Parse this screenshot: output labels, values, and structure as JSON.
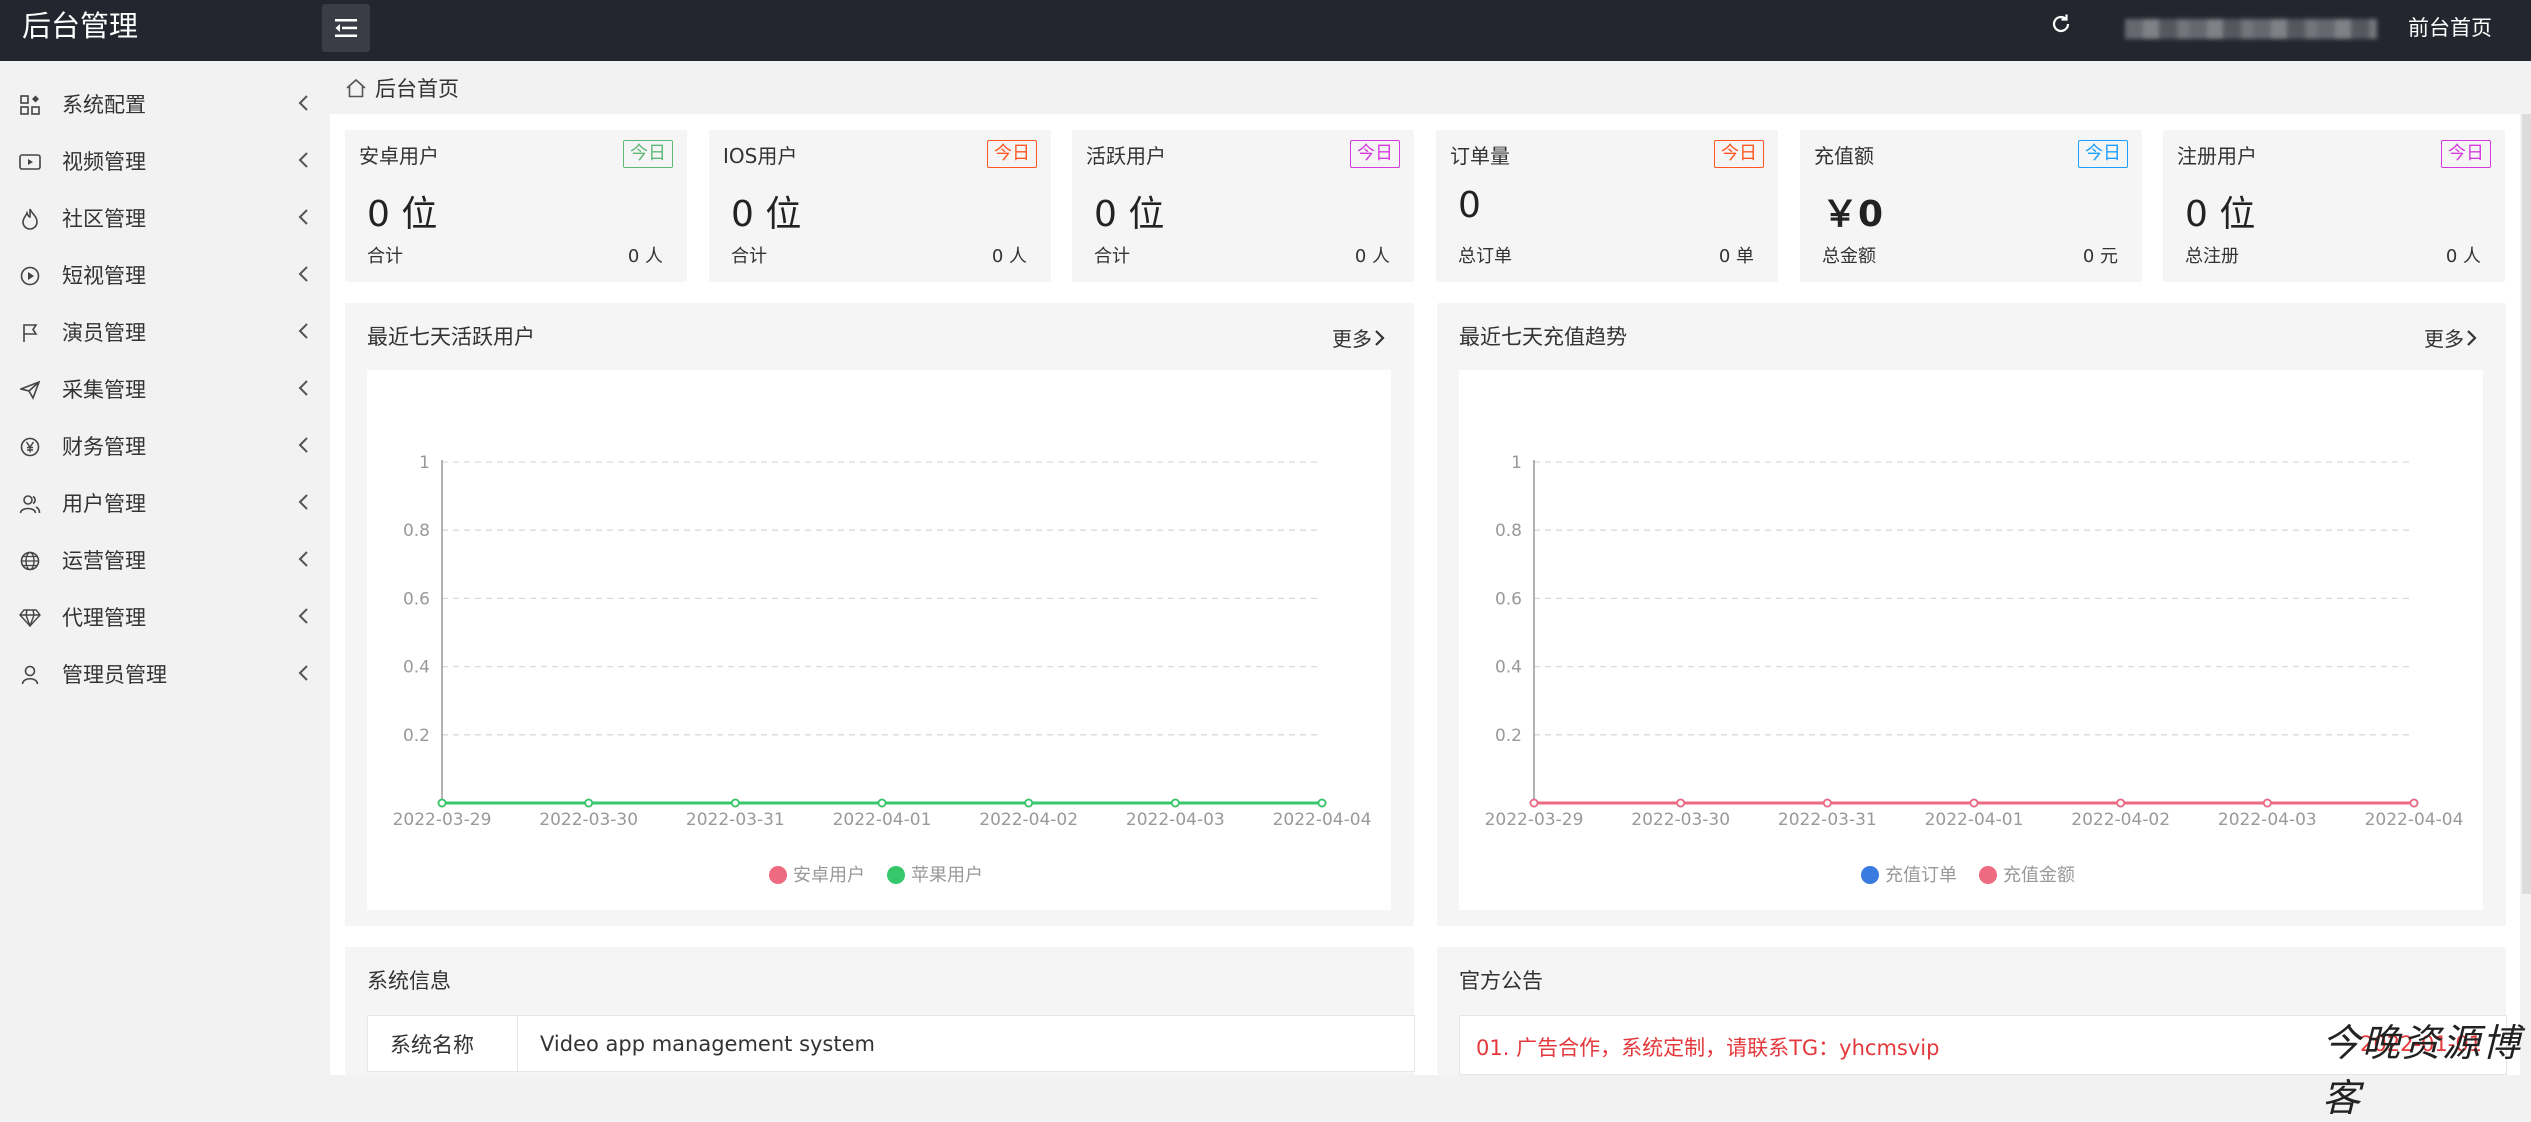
{
  "header": {
    "logo": "后台管理",
    "front_home": "前台首页"
  },
  "sidebar": {
    "items": [
      {
        "label": "系统配置",
        "icon": "grid-icon"
      },
      {
        "label": "视频管理",
        "icon": "video-icon"
      },
      {
        "label": "社区管理",
        "icon": "fire-icon"
      },
      {
        "label": "短视管理",
        "icon": "play-circle-icon"
      },
      {
        "label": "演员管理",
        "icon": "flag-icon"
      },
      {
        "label": "采集管理",
        "icon": "send-icon"
      },
      {
        "label": "财务管理",
        "icon": "yen-icon"
      },
      {
        "label": "用户管理",
        "icon": "users-icon"
      },
      {
        "label": "运营管理",
        "icon": "globe-icon"
      },
      {
        "label": "代理管理",
        "icon": "diamond-icon"
      },
      {
        "label": "管理员管理",
        "icon": "user-icon"
      }
    ]
  },
  "breadcrumb": {
    "home": "后台首页"
  },
  "stats": [
    {
      "title": "安卓用户",
      "badge": "今日",
      "badge_color": "#5fb878",
      "value": "0 位",
      "foot_label": "合计",
      "foot_value": "0 人"
    },
    {
      "title": "IOS用户",
      "badge": "今日",
      "badge_color": "#ff5722",
      "value": "0 位",
      "foot_label": "合计",
      "foot_value": "0 人"
    },
    {
      "title": "活跃用户",
      "badge": "今日",
      "badge_color": "#d63adf",
      "value": "0 位",
      "foot_label": "合计",
      "foot_value": "0 人"
    },
    {
      "title": "订单量",
      "badge": "今日",
      "badge_color": "#ff5722",
      "value": "0",
      "foot_label": "总订单",
      "foot_value": "0 单"
    },
    {
      "title": "充值额",
      "badge": "今日",
      "badge_color": "#1e9fff",
      "value": "￥0",
      "foot_label": "总金额",
      "foot_value": "0 元"
    },
    {
      "title": "注册用户",
      "badge": "今日",
      "badge_color": "#d63adf",
      "value": "0 位",
      "foot_label": "总注册",
      "foot_value": "0 人"
    }
  ],
  "panels": {
    "active_users": {
      "title": "最近七天活跃用户",
      "more": "更多"
    },
    "recharge": {
      "title": "最近七天充值趋势",
      "more": "更多"
    },
    "system_info": {
      "title": "系统信息",
      "rows": [
        {
          "key": "系统名称",
          "value": "Video app management system"
        }
      ]
    },
    "notice": {
      "title": "官方公告",
      "items": [
        {
          "text": "01. 广告合作，系统定制，请联系TG：yhcmsvip",
          "date": "2022-01-01"
        }
      ]
    }
  },
  "chart_data": [
    {
      "type": "line",
      "x": [
        "2022-03-29",
        "2022-03-30",
        "2022-03-31",
        "2022-04-01",
        "2022-04-02",
        "2022-04-03",
        "2022-04-04"
      ],
      "ylim": [
        0,
        1
      ],
      "yticks": [
        "1",
        "0.8",
        "0.6",
        "0.4",
        "0.2"
      ],
      "series": [
        {
          "name": "安卓用户",
          "color": "#ee6a80",
          "values": [
            0,
            0,
            0,
            0,
            0,
            0,
            0
          ]
        },
        {
          "name": "苹果用户",
          "color": "#35c76a",
          "values": [
            0,
            0,
            0,
            0,
            0,
            0,
            0
          ]
        }
      ],
      "legend": "bottom-center",
      "grid": true
    },
    {
      "type": "line",
      "x": [
        "2022-03-29",
        "2022-03-30",
        "2022-03-31",
        "2022-04-01",
        "2022-04-02",
        "2022-04-03",
        "2022-04-04"
      ],
      "ylim": [
        0,
        1
      ],
      "yticks": [
        "1",
        "0.8",
        "0.6",
        "0.4",
        "0.2"
      ],
      "series": [
        {
          "name": "充值订单",
          "color": "#3a7be0",
          "values": [
            0,
            0,
            0,
            0,
            0,
            0,
            0
          ]
        },
        {
          "name": "充值金额",
          "color": "#ee6a80",
          "values": [
            0,
            0,
            0,
            0,
            0,
            0,
            0
          ]
        }
      ],
      "legend": "bottom-center",
      "grid": true
    }
  ],
  "watermark": "今晚资源博客"
}
